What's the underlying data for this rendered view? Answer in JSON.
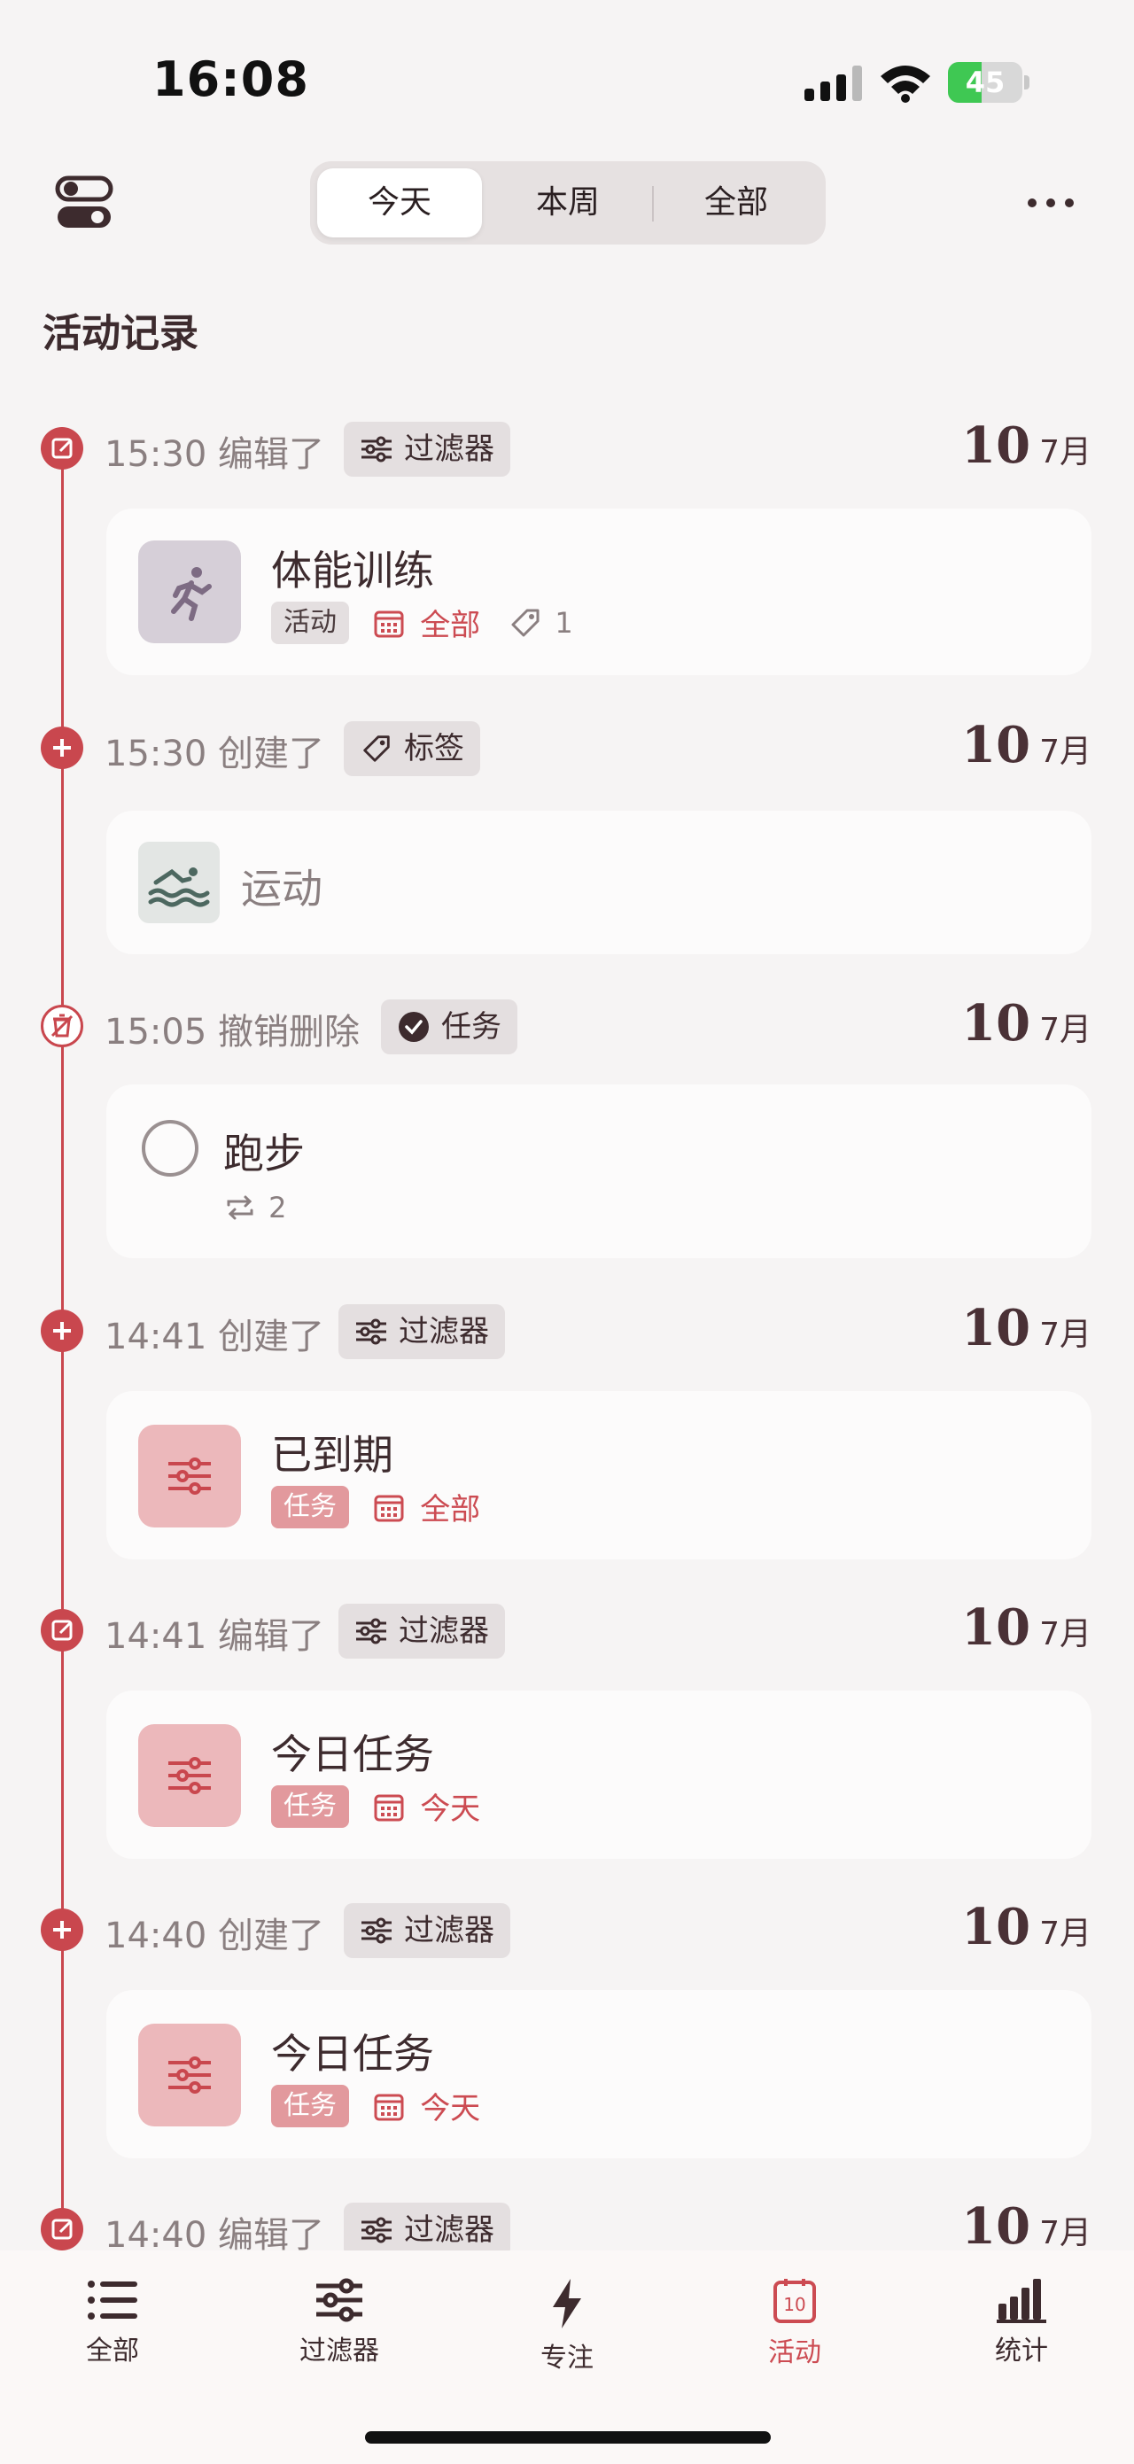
{
  "status_bar": {
    "time": "16:08",
    "battery": "45",
    "battery_level": 0.45
  },
  "header": {
    "segments": [
      "今天",
      "本周",
      "全部"
    ],
    "active_segment": 0
  },
  "page": {
    "title": "活动记录"
  },
  "colors": {
    "accent": "#c9474e",
    "accent_text": "#cc4b52",
    "background": "#f6f4f4",
    "card": "#fcfbfb",
    "chip": "#e4dfe0"
  },
  "entries": [
    {
      "icon": "edit-icon",
      "time": "15:30 编辑了",
      "type_icon": "filter-icon",
      "type_label": "过滤器",
      "day": "10",
      "month": "7月",
      "card": {
        "thumb": "runner-icon",
        "thumb_color": "#d6cfd8",
        "title": "体能训练",
        "tag": "活动",
        "tag_style": "grey",
        "scope": "全部",
        "label_count": "1"
      }
    },
    {
      "icon": "plus-icon",
      "time": "15:30 创建了",
      "type_icon": "tag-icon",
      "type_label": "标签",
      "day": "10",
      "month": "7月",
      "card": {
        "thumb": "swimmer-icon",
        "thumb_color": "#e3e6e4",
        "title": "运动"
      }
    },
    {
      "icon": "restore-icon",
      "time": "15:05 撤销删除",
      "type_icon": "check-circle-icon",
      "type_label": "任务",
      "day": "10",
      "month": "7月",
      "card": {
        "title": "跑步",
        "repeat_count": "2"
      }
    },
    {
      "icon": "plus-icon",
      "time": "14:41 创建了",
      "type_icon": "filter-icon",
      "type_label": "过滤器",
      "day": "10",
      "month": "7月",
      "card": {
        "thumb": "filter-icon",
        "thumb_color": "#ecb8bb",
        "title": "已到期",
        "tag": "任务",
        "tag_style": "red",
        "scope": "全部"
      }
    },
    {
      "icon": "edit-icon",
      "time": "14:41 编辑了",
      "type_icon": "filter-icon",
      "type_label": "过滤器",
      "day": "10",
      "month": "7月",
      "card": {
        "thumb": "filter-icon",
        "thumb_color": "#ecb8bb",
        "title": "今日任务",
        "tag": "任务",
        "tag_style": "red",
        "scope": "今天"
      }
    },
    {
      "icon": "plus-icon",
      "time": "14:40 创建了",
      "type_icon": "filter-icon",
      "type_label": "过滤器",
      "day": "10",
      "month": "7月",
      "card": {
        "thumb": "filter-icon",
        "thumb_color": "#ecb8bb",
        "title": "今日任务",
        "tag": "任务",
        "tag_style": "red",
        "scope": "今天"
      }
    },
    {
      "icon": "edit-icon",
      "time": "14:40 编辑了",
      "type_icon": "filter-icon",
      "type_label": "过滤器",
      "day": "10",
      "month": "7月"
    }
  ],
  "tabbar": {
    "items": [
      {
        "label": "全部",
        "icon": "list-icon"
      },
      {
        "label": "过滤器",
        "icon": "sliders-icon"
      },
      {
        "label": "专注",
        "icon": "bolt-icon"
      },
      {
        "label": "活动",
        "icon": "calendar-day-icon",
        "badge": "10",
        "active": true
      },
      {
        "label": "统计",
        "icon": "bar-chart-icon"
      }
    ]
  }
}
